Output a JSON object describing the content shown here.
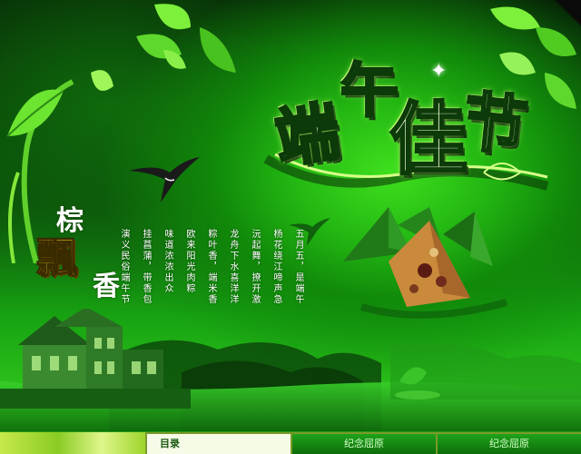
{
  "title": {
    "chars": [
      "端",
      "午",
      "佳",
      "节"
    ]
  },
  "poem_title": {
    "zong": "棕",
    "piao": "飄",
    "xiang": "香"
  },
  "poem_columns": [
    "五月五，是端午",
    "杨花绕江啼声急",
    "沅起舞，撩开激",
    "龙舟下水喜洋洋",
    "粽叶香，端米香",
    "欧来阳光肉粽",
    "味道浓浓出众",
    "挂菖蒲，带香包",
    "演义民俗端午节"
  ],
  "nav": {
    "tabs": [
      "目录",
      "纪念屈原",
      "纪念屈原"
    ]
  },
  "colors": {
    "accent": "#22b512",
    "dark": "#062406",
    "highlight": "#ffe81a"
  }
}
